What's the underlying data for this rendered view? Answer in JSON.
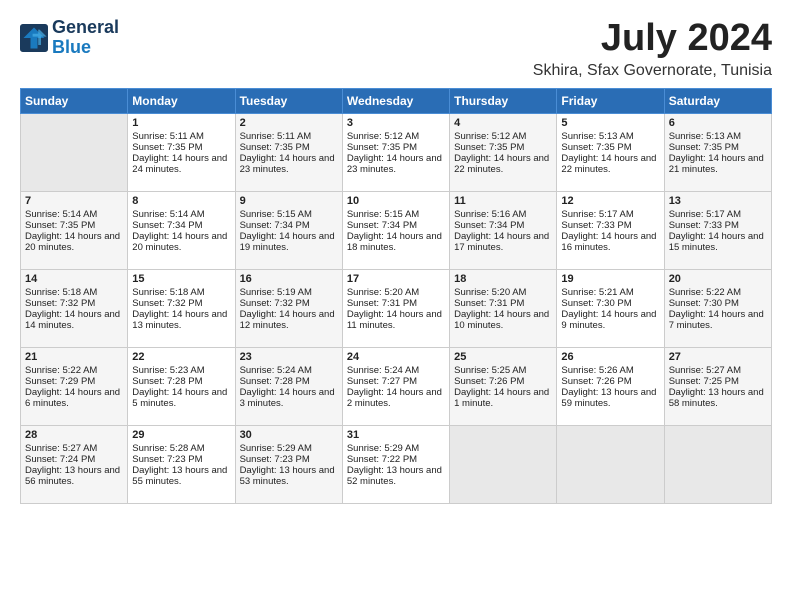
{
  "header": {
    "logo_line1": "General",
    "logo_line2": "Blue",
    "title": "July 2024",
    "subtitle": "Skhira, Sfax Governorate, Tunisia"
  },
  "days_of_week": [
    "Sunday",
    "Monday",
    "Tuesday",
    "Wednesday",
    "Thursday",
    "Friday",
    "Saturday"
  ],
  "weeks": [
    [
      {
        "day": "",
        "empty": true
      },
      {
        "day": "1",
        "sunrise": "Sunrise: 5:11 AM",
        "sunset": "Sunset: 7:35 PM",
        "daylight": "Daylight: 14 hours and 24 minutes."
      },
      {
        "day": "2",
        "sunrise": "Sunrise: 5:11 AM",
        "sunset": "Sunset: 7:35 PM",
        "daylight": "Daylight: 14 hours and 23 minutes."
      },
      {
        "day": "3",
        "sunrise": "Sunrise: 5:12 AM",
        "sunset": "Sunset: 7:35 PM",
        "daylight": "Daylight: 14 hours and 23 minutes."
      },
      {
        "day": "4",
        "sunrise": "Sunrise: 5:12 AM",
        "sunset": "Sunset: 7:35 PM",
        "daylight": "Daylight: 14 hours and 22 minutes."
      },
      {
        "day": "5",
        "sunrise": "Sunrise: 5:13 AM",
        "sunset": "Sunset: 7:35 PM",
        "daylight": "Daylight: 14 hours and 22 minutes."
      },
      {
        "day": "6",
        "sunrise": "Sunrise: 5:13 AM",
        "sunset": "Sunset: 7:35 PM",
        "daylight": "Daylight: 14 hours and 21 minutes."
      }
    ],
    [
      {
        "day": "7",
        "sunrise": "Sunrise: 5:14 AM",
        "sunset": "Sunset: 7:35 PM",
        "daylight": "Daylight: 14 hours and 20 minutes."
      },
      {
        "day": "8",
        "sunrise": "Sunrise: 5:14 AM",
        "sunset": "Sunset: 7:34 PM",
        "daylight": "Daylight: 14 hours and 20 minutes."
      },
      {
        "day": "9",
        "sunrise": "Sunrise: 5:15 AM",
        "sunset": "Sunset: 7:34 PM",
        "daylight": "Daylight: 14 hours and 19 minutes."
      },
      {
        "day": "10",
        "sunrise": "Sunrise: 5:15 AM",
        "sunset": "Sunset: 7:34 PM",
        "daylight": "Daylight: 14 hours and 18 minutes."
      },
      {
        "day": "11",
        "sunrise": "Sunrise: 5:16 AM",
        "sunset": "Sunset: 7:34 PM",
        "daylight": "Daylight: 14 hours and 17 minutes."
      },
      {
        "day": "12",
        "sunrise": "Sunrise: 5:17 AM",
        "sunset": "Sunset: 7:33 PM",
        "daylight": "Daylight: 14 hours and 16 minutes."
      },
      {
        "day": "13",
        "sunrise": "Sunrise: 5:17 AM",
        "sunset": "Sunset: 7:33 PM",
        "daylight": "Daylight: 14 hours and 15 minutes."
      }
    ],
    [
      {
        "day": "14",
        "sunrise": "Sunrise: 5:18 AM",
        "sunset": "Sunset: 7:32 PM",
        "daylight": "Daylight: 14 hours and 14 minutes."
      },
      {
        "day": "15",
        "sunrise": "Sunrise: 5:18 AM",
        "sunset": "Sunset: 7:32 PM",
        "daylight": "Daylight: 14 hours and 13 minutes."
      },
      {
        "day": "16",
        "sunrise": "Sunrise: 5:19 AM",
        "sunset": "Sunset: 7:32 PM",
        "daylight": "Daylight: 14 hours and 12 minutes."
      },
      {
        "day": "17",
        "sunrise": "Sunrise: 5:20 AM",
        "sunset": "Sunset: 7:31 PM",
        "daylight": "Daylight: 14 hours and 11 minutes."
      },
      {
        "day": "18",
        "sunrise": "Sunrise: 5:20 AM",
        "sunset": "Sunset: 7:31 PM",
        "daylight": "Daylight: 14 hours and 10 minutes."
      },
      {
        "day": "19",
        "sunrise": "Sunrise: 5:21 AM",
        "sunset": "Sunset: 7:30 PM",
        "daylight": "Daylight: 14 hours and 9 minutes."
      },
      {
        "day": "20",
        "sunrise": "Sunrise: 5:22 AM",
        "sunset": "Sunset: 7:30 PM",
        "daylight": "Daylight: 14 hours and 7 minutes."
      }
    ],
    [
      {
        "day": "21",
        "sunrise": "Sunrise: 5:22 AM",
        "sunset": "Sunset: 7:29 PM",
        "daylight": "Daylight: 14 hours and 6 minutes."
      },
      {
        "day": "22",
        "sunrise": "Sunrise: 5:23 AM",
        "sunset": "Sunset: 7:28 PM",
        "daylight": "Daylight: 14 hours and 5 minutes."
      },
      {
        "day": "23",
        "sunrise": "Sunrise: 5:24 AM",
        "sunset": "Sunset: 7:28 PM",
        "daylight": "Daylight: 14 hours and 3 minutes."
      },
      {
        "day": "24",
        "sunrise": "Sunrise: 5:24 AM",
        "sunset": "Sunset: 7:27 PM",
        "daylight": "Daylight: 14 hours and 2 minutes."
      },
      {
        "day": "25",
        "sunrise": "Sunrise: 5:25 AM",
        "sunset": "Sunset: 7:26 PM",
        "daylight": "Daylight: 14 hours and 1 minute."
      },
      {
        "day": "26",
        "sunrise": "Sunrise: 5:26 AM",
        "sunset": "Sunset: 7:26 PM",
        "daylight": "Daylight: 13 hours and 59 minutes."
      },
      {
        "day": "27",
        "sunrise": "Sunrise: 5:27 AM",
        "sunset": "Sunset: 7:25 PM",
        "daylight": "Daylight: 13 hours and 58 minutes."
      }
    ],
    [
      {
        "day": "28",
        "sunrise": "Sunrise: 5:27 AM",
        "sunset": "Sunset: 7:24 PM",
        "daylight": "Daylight: 13 hours and 56 minutes."
      },
      {
        "day": "29",
        "sunrise": "Sunrise: 5:28 AM",
        "sunset": "Sunset: 7:23 PM",
        "daylight": "Daylight: 13 hours and 55 minutes."
      },
      {
        "day": "30",
        "sunrise": "Sunrise: 5:29 AM",
        "sunset": "Sunset: 7:23 PM",
        "daylight": "Daylight: 13 hours and 53 minutes."
      },
      {
        "day": "31",
        "sunrise": "Sunrise: 5:29 AM",
        "sunset": "Sunset: 7:22 PM",
        "daylight": "Daylight: 13 hours and 52 minutes."
      },
      {
        "day": "",
        "empty": true
      },
      {
        "day": "",
        "empty": true
      },
      {
        "day": "",
        "empty": true
      }
    ]
  ]
}
